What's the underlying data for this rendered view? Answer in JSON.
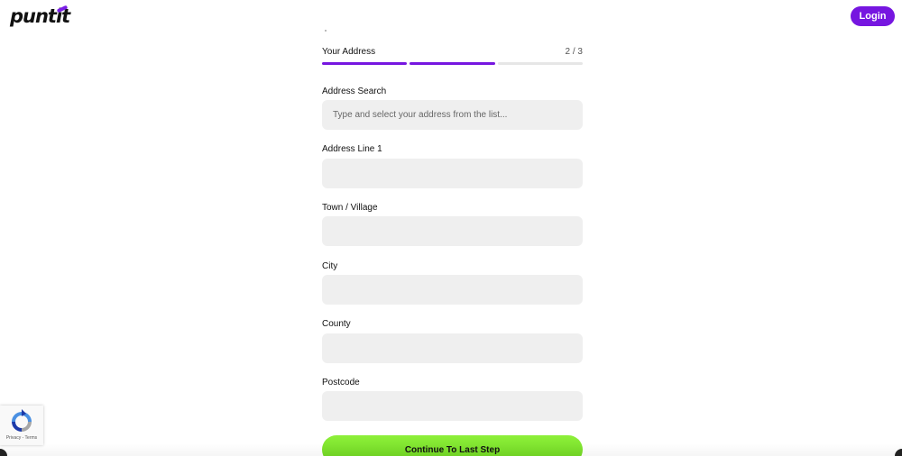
{
  "header": {
    "logo_text": "puntit",
    "login_label": "Login"
  },
  "form": {
    "step_title": "Your Address",
    "step_count": "2 / 3",
    "progress": {
      "current_step": 2,
      "total_steps": 3
    },
    "fields": {
      "address_search": {
        "label": "Address Search",
        "placeholder": "Type and select your address from the list...",
        "value": ""
      },
      "address_line_1": {
        "label": "Address Line 1",
        "value": ""
      },
      "town_village": {
        "label": "Town / Village",
        "value": ""
      },
      "city": {
        "label": "City",
        "value": ""
      },
      "county": {
        "label": "County",
        "value": ""
      },
      "postcode": {
        "label": "Postcode",
        "value": ""
      }
    },
    "continue_label": "Continue To Last Step"
  },
  "recaptcha": {
    "links": "Privacy - Terms"
  },
  "colors": {
    "brand_purple": "#7616e0",
    "continue_green": "#7ddf2b",
    "input_bg": "#efefef"
  }
}
